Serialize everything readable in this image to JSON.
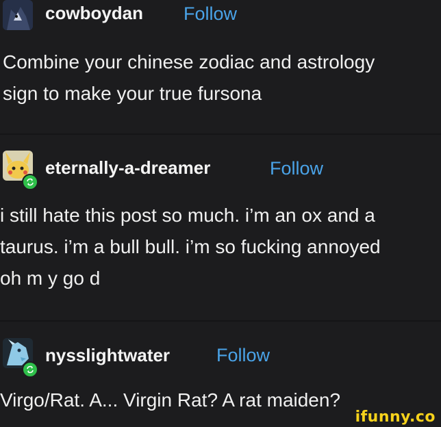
{
  "posts": [
    {
      "username": "cowboydan",
      "follow_label": "Follow",
      "avatar_icon": "wolf-avatar-icon",
      "lines": [
        "Combine your chinese zodiac and astrology",
        "sign to make your true fursona"
      ]
    },
    {
      "username": "eternally-a-dreamer",
      "follow_label": "Follow",
      "avatar_icon": "pikachu-avatar-icon",
      "lines": [
        "i still hate this post so much. i’m an ox and a",
        "taurus. i’m a bull bull. i’m so fucking annoyed",
        "oh m y go d"
      ]
    },
    {
      "username": "nysslightwater",
      "follow_label": "Follow",
      "avatar_icon": "dragon-avatar-icon",
      "lines": [
        "Virgo/Rat. A... Virgin Rat? A rat maiden?"
      ]
    }
  ],
  "watermark": "ifunny.co",
  "colors": {
    "background": "#1c1c1e",
    "follow": "#4aa3e8",
    "reblog": "#2fbf4a",
    "watermark": "#f6d21b"
  }
}
